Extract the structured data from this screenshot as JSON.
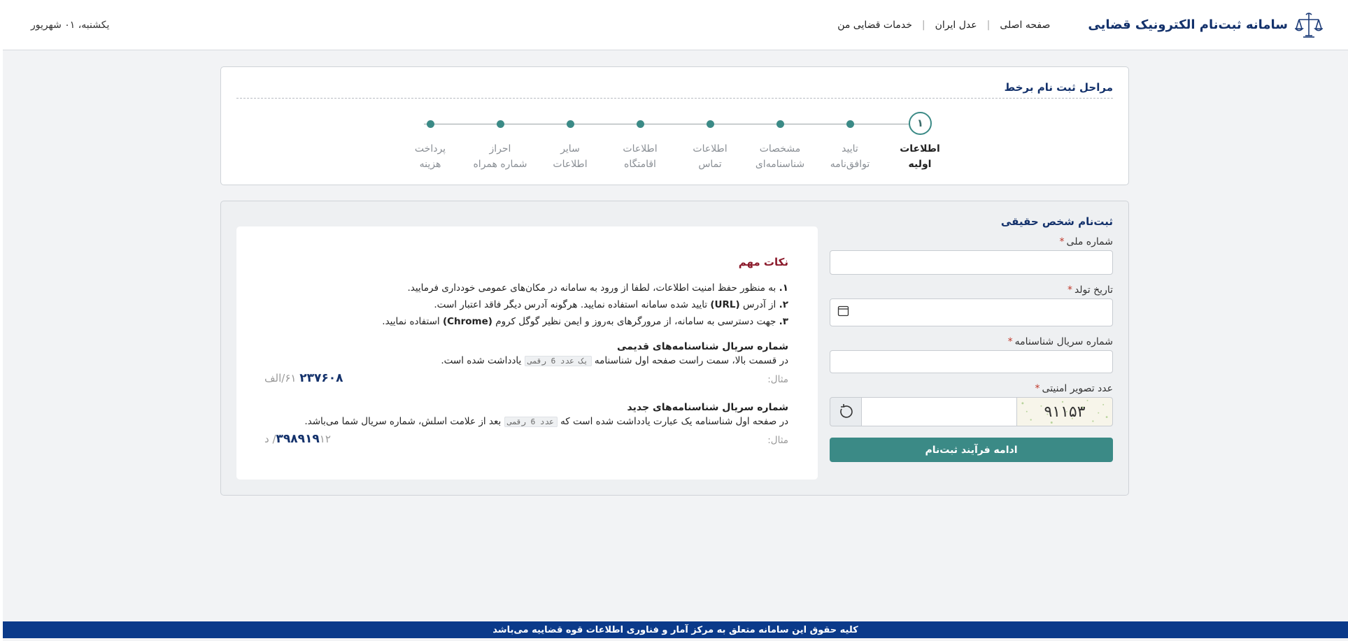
{
  "header": {
    "title": "سامانه ثبت‌نام الکترونیک قضایی",
    "nav": [
      "صفحه اصلی",
      "عدل ایران",
      "خدمات قضایی من"
    ],
    "date": "یکشنبه، ۰۱ شهریور"
  },
  "steps": {
    "title": "مراحل ثبت نام برخط",
    "current_number": "۱",
    "items": [
      {
        "line1": "اطلاعات",
        "line2": "اولیه"
      },
      {
        "line1": "تایید",
        "line2": "توافق‌نامه"
      },
      {
        "line1": "مشخصات",
        "line2": "شناسنامه‌ای"
      },
      {
        "line1": "اطلاعات",
        "line2": "تماس"
      },
      {
        "line1": "اطلاعات",
        "line2": "اقامتگاه"
      },
      {
        "line1": "سایر",
        "line2": "اطلاعات"
      },
      {
        "line1": "احراز",
        "line2": "شماره همراه"
      },
      {
        "line1": "پرداخت",
        "line2": "هزینه"
      }
    ]
  },
  "form": {
    "title": "ثبت‌نام شخص حقیقی",
    "national_id_label": "شماره ملی",
    "birth_date_label": "تاریخ تولد",
    "serial_label": "شماره سریال شناسنامه",
    "captcha_label": "عدد تصویر امنیتی",
    "captcha_text": "۹۱۱۵۳",
    "required_mark": "*",
    "submit_label": "ادامه فرآیند ثبت‌نام"
  },
  "notes": {
    "title": "نکات مهم",
    "items": [
      {
        "num": "۱.",
        "text": "به منظور حفظ امنیت اطلاعات، لطفا از ورود به سامانه در مکان‌های عمومی خودداری فرمایید."
      },
      {
        "num": "۲.",
        "pre": "از آدرس ",
        "bold": "(URL)",
        "post": " تایید شده سامانه استفاده نمایید. هرگونه آدرس دیگر فاقد اعتبار است."
      },
      {
        "num": "۳.",
        "pre": "جهت دسترسی به سامانه، از مرورگرهای به‌روز و ایمن نظیر گوگل کروم ",
        "bold": "(Chrome)",
        "post": " استفاده نمایید."
      }
    ],
    "old_serial": {
      "title": "شماره سریال شناسنامه‌های قدیمی",
      "pre": "در قسمت بالا، سمت راست صفحه اول شناسنامه ",
      "code": "یک عدد 6 رقمی",
      "post": " یادداشت شده است.",
      "example_label": "مثال:",
      "example_main": "۲۳۷۶۰۸",
      "example_rest": " ۶۱/الف"
    },
    "new_serial": {
      "title": "شماره سریال شناسنامه‌های جدید",
      "pre": "در صفحه اول شناسنامه یک عبارت یادداشت شده است که ",
      "code": "عدد 6 رقمی",
      "post": " بعد از علامت اسلش، شماره سریال شما می‌باشد.",
      "example_label": "مثال:",
      "example_main": "۳۹۸۹۱۹",
      "example_rest": "۱۲/ د"
    }
  },
  "footer": {
    "text": "کلیه حقوق این سامانه متعلق به مرکز آمار و فناوری اطلاعات قوه قضاییه می‌باشد"
  },
  "colors": {
    "accent": "#3b8a86",
    "brand": "#13316b",
    "footer": "#0b3a8a",
    "notes_title": "#8b1a2b"
  }
}
